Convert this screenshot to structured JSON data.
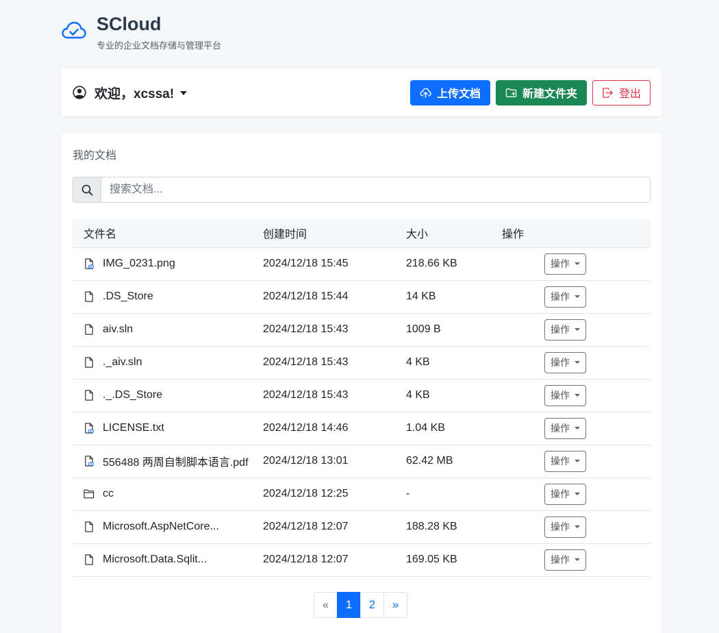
{
  "brand": {
    "title": "SCloud",
    "subtitle": "专业的企业文档存储与管理平台",
    "accent": "#0d6efd"
  },
  "header": {
    "user_icon": "user-circle-icon",
    "welcome": "欢迎，xcssa!",
    "upload_label": "上传文档",
    "new_folder_label": "新建文件夹",
    "logout_label": "登出"
  },
  "main": {
    "title": "我的文档",
    "search": {
      "placeholder": "搜索文档...",
      "value": ""
    },
    "columns": [
      "文件名",
      "创建时间",
      "大小",
      "操作"
    ],
    "rows": [
      {
        "icon": "file-image-icon",
        "name": "IMG_0231.png",
        "created": "2024/12/18 15:45",
        "size": "218.66 KB",
        "action": "操作"
      },
      {
        "icon": "file-icon",
        "name": ".DS_Store",
        "created": "2024/12/18 15:44",
        "size": "14 KB",
        "action": "操作"
      },
      {
        "icon": "file-icon",
        "name": "aiv.sln",
        "created": "2024/12/18 15:43",
        "size": "1009 B",
        "action": "操作"
      },
      {
        "icon": "file-icon",
        "name": "._aiv.sln",
        "created": "2024/12/18 15:43",
        "size": "4 KB",
        "action": "操作"
      },
      {
        "icon": "file-icon",
        "name": "._.DS_Store",
        "created": "2024/12/18 15:43",
        "size": "4 KB",
        "action": "操作"
      },
      {
        "icon": "file-preview-icon",
        "name": "LICENSE.txt",
        "created": "2024/12/18 14:46",
        "size": "1.04 KB",
        "action": "操作"
      },
      {
        "icon": "file-preview-icon",
        "name": "556488 两周自制脚本语言.pdf",
        "created": "2024/12/18 13:01",
        "size": "62.42 MB",
        "action": "操作"
      },
      {
        "icon": "folder-icon",
        "name": "cc",
        "created": "2024/12/18 12:25",
        "size": "-",
        "action": "操作"
      },
      {
        "icon": "file-icon",
        "name": "Microsoft.AspNetCore...",
        "created": "2024/12/18 12:07",
        "size": "188.28 KB",
        "action": "操作"
      },
      {
        "icon": "file-icon",
        "name": "Microsoft.Data.Sqlit...",
        "created": "2024/12/18 12:07",
        "size": "169.05 KB",
        "action": "操作"
      }
    ]
  },
  "pagination": {
    "prev": "«",
    "pages": [
      "1",
      "2"
    ],
    "current": "1",
    "next": "»"
  }
}
